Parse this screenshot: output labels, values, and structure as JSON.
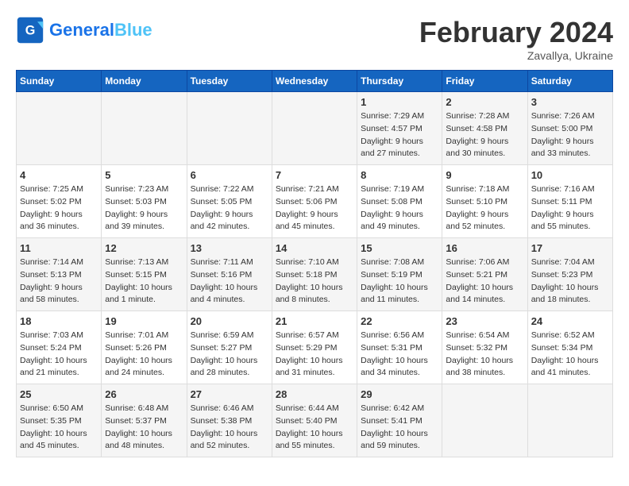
{
  "header": {
    "logo_general": "General",
    "logo_blue": "Blue",
    "month_title": "February 2024",
    "location": "Zavallya, Ukraine"
  },
  "calendar": {
    "columns": [
      "Sunday",
      "Monday",
      "Tuesday",
      "Wednesday",
      "Thursday",
      "Friday",
      "Saturday"
    ],
    "rows": [
      [
        {
          "day": "",
          "info": ""
        },
        {
          "day": "",
          "info": ""
        },
        {
          "day": "",
          "info": ""
        },
        {
          "day": "",
          "info": ""
        },
        {
          "day": "1",
          "info": "Sunrise: 7:29 AM\nSunset: 4:57 PM\nDaylight: 9 hours\nand 27 minutes."
        },
        {
          "day": "2",
          "info": "Sunrise: 7:28 AM\nSunset: 4:58 PM\nDaylight: 9 hours\nand 30 minutes."
        },
        {
          "day": "3",
          "info": "Sunrise: 7:26 AM\nSunset: 5:00 PM\nDaylight: 9 hours\nand 33 minutes."
        }
      ],
      [
        {
          "day": "4",
          "info": "Sunrise: 7:25 AM\nSunset: 5:02 PM\nDaylight: 9 hours\nand 36 minutes."
        },
        {
          "day": "5",
          "info": "Sunrise: 7:23 AM\nSunset: 5:03 PM\nDaylight: 9 hours\nand 39 minutes."
        },
        {
          "day": "6",
          "info": "Sunrise: 7:22 AM\nSunset: 5:05 PM\nDaylight: 9 hours\nand 42 minutes."
        },
        {
          "day": "7",
          "info": "Sunrise: 7:21 AM\nSunset: 5:06 PM\nDaylight: 9 hours\nand 45 minutes."
        },
        {
          "day": "8",
          "info": "Sunrise: 7:19 AM\nSunset: 5:08 PM\nDaylight: 9 hours\nand 49 minutes."
        },
        {
          "day": "9",
          "info": "Sunrise: 7:18 AM\nSunset: 5:10 PM\nDaylight: 9 hours\nand 52 minutes."
        },
        {
          "day": "10",
          "info": "Sunrise: 7:16 AM\nSunset: 5:11 PM\nDaylight: 9 hours\nand 55 minutes."
        }
      ],
      [
        {
          "day": "11",
          "info": "Sunrise: 7:14 AM\nSunset: 5:13 PM\nDaylight: 9 hours\nand 58 minutes."
        },
        {
          "day": "12",
          "info": "Sunrise: 7:13 AM\nSunset: 5:15 PM\nDaylight: 10 hours\nand 1 minute."
        },
        {
          "day": "13",
          "info": "Sunrise: 7:11 AM\nSunset: 5:16 PM\nDaylight: 10 hours\nand 4 minutes."
        },
        {
          "day": "14",
          "info": "Sunrise: 7:10 AM\nSunset: 5:18 PM\nDaylight: 10 hours\nand 8 minutes."
        },
        {
          "day": "15",
          "info": "Sunrise: 7:08 AM\nSunset: 5:19 PM\nDaylight: 10 hours\nand 11 minutes."
        },
        {
          "day": "16",
          "info": "Sunrise: 7:06 AM\nSunset: 5:21 PM\nDaylight: 10 hours\nand 14 minutes."
        },
        {
          "day": "17",
          "info": "Sunrise: 7:04 AM\nSunset: 5:23 PM\nDaylight: 10 hours\nand 18 minutes."
        }
      ],
      [
        {
          "day": "18",
          "info": "Sunrise: 7:03 AM\nSunset: 5:24 PM\nDaylight: 10 hours\nand 21 minutes."
        },
        {
          "day": "19",
          "info": "Sunrise: 7:01 AM\nSunset: 5:26 PM\nDaylight: 10 hours\nand 24 minutes."
        },
        {
          "day": "20",
          "info": "Sunrise: 6:59 AM\nSunset: 5:27 PM\nDaylight: 10 hours\nand 28 minutes."
        },
        {
          "day": "21",
          "info": "Sunrise: 6:57 AM\nSunset: 5:29 PM\nDaylight: 10 hours\nand 31 minutes."
        },
        {
          "day": "22",
          "info": "Sunrise: 6:56 AM\nSunset: 5:31 PM\nDaylight: 10 hours\nand 34 minutes."
        },
        {
          "day": "23",
          "info": "Sunrise: 6:54 AM\nSunset: 5:32 PM\nDaylight: 10 hours\nand 38 minutes."
        },
        {
          "day": "24",
          "info": "Sunrise: 6:52 AM\nSunset: 5:34 PM\nDaylight: 10 hours\nand 41 minutes."
        }
      ],
      [
        {
          "day": "25",
          "info": "Sunrise: 6:50 AM\nSunset: 5:35 PM\nDaylight: 10 hours\nand 45 minutes."
        },
        {
          "day": "26",
          "info": "Sunrise: 6:48 AM\nSunset: 5:37 PM\nDaylight: 10 hours\nand 48 minutes."
        },
        {
          "day": "27",
          "info": "Sunrise: 6:46 AM\nSunset: 5:38 PM\nDaylight: 10 hours\nand 52 minutes."
        },
        {
          "day": "28",
          "info": "Sunrise: 6:44 AM\nSunset: 5:40 PM\nDaylight: 10 hours\nand 55 minutes."
        },
        {
          "day": "29",
          "info": "Sunrise: 6:42 AM\nSunset: 5:41 PM\nDaylight: 10 hours\nand 59 minutes."
        },
        {
          "day": "",
          "info": ""
        },
        {
          "day": "",
          "info": ""
        }
      ]
    ]
  }
}
